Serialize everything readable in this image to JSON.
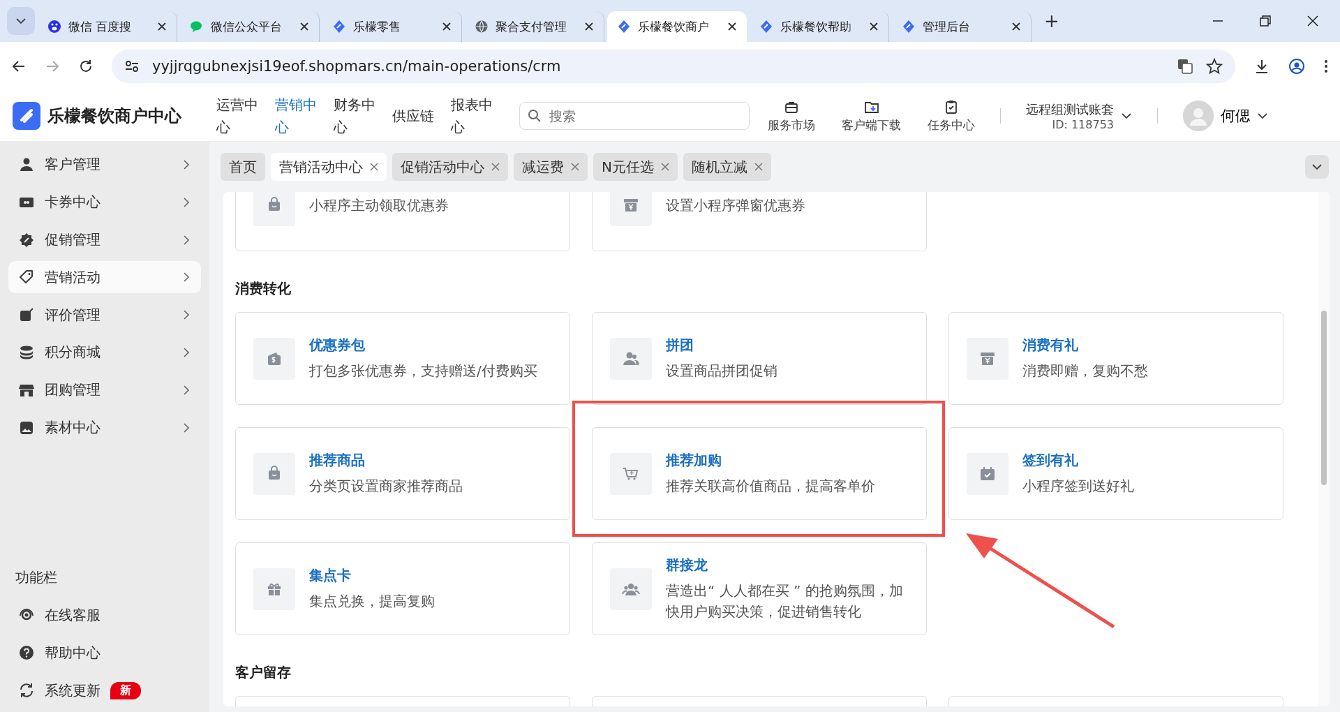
{
  "browser": {
    "tabs": [
      {
        "title": "微信 百度搜",
        "kind": "paw",
        "selected": false
      },
      {
        "title": "微信公众平台",
        "kind": "chat",
        "selected": false
      },
      {
        "title": "乐檬零售",
        "kind": "logo",
        "selected": false
      },
      {
        "title": "聚合支付管理",
        "kind": "globe",
        "selected": false
      },
      {
        "title": "乐檬餐饮商户",
        "kind": "logo",
        "selected": true
      },
      {
        "title": "乐檬餐饮帮助",
        "kind": "logo",
        "selected": false
      },
      {
        "title": "管理后台",
        "kind": "logo",
        "selected": false
      }
    ],
    "new_tab": "+",
    "url": "yyjjrqgubnexjsi19eof.shopmars.cn/main-operations/crm"
  },
  "header": {
    "brand": "乐檬餐饮商户中心",
    "nav": [
      {
        "label": "运营中心",
        "selected": false
      },
      {
        "label": "营销中心",
        "selected": true
      },
      {
        "label": "财务中心",
        "selected": false
      },
      {
        "label": "供应链",
        "selected": false
      },
      {
        "label": "报表中心",
        "selected": false
      }
    ],
    "search": {
      "placeholder": "搜索"
    },
    "tools": [
      {
        "label": "服务市场",
        "kind": "bag"
      },
      {
        "label": "客户端下载",
        "kind": "folder"
      },
      {
        "label": "任务中心",
        "kind": "clipboard"
      }
    ],
    "account": {
      "name": "远程组测试账套",
      "id": "ID: 118753"
    },
    "user": "何偲"
  },
  "page_tabs": [
    {
      "label": "首页",
      "selected": false,
      "closable": false
    },
    {
      "label": "营销活动中心",
      "selected": true,
      "closable": true
    },
    {
      "label": "促销活动中心",
      "selected": false,
      "closable": true
    },
    {
      "label": "减运费",
      "selected": false,
      "closable": true
    },
    {
      "label": "N元任选",
      "selected": false,
      "closable": true
    },
    {
      "label": "随机立减",
      "selected": false,
      "closable": true
    }
  ],
  "sidebar": {
    "items": [
      {
        "label": "客户管理",
        "kind": "person",
        "selected": false
      },
      {
        "label": "卡券中心",
        "kind": "ticket",
        "selected": false
      },
      {
        "label": "促销管理",
        "kind": "discount",
        "selected": false
      },
      {
        "label": "营销活动",
        "kind": "tag",
        "selected": true
      },
      {
        "label": "评价管理",
        "kind": "edit",
        "selected": false
      },
      {
        "label": "积分商城",
        "kind": "coins",
        "selected": false
      },
      {
        "label": "团购管理",
        "kind": "store",
        "selected": false
      },
      {
        "label": "素材中心",
        "kind": "image",
        "selected": false
      }
    ],
    "section_title": "功能栏",
    "tools": [
      {
        "label": "在线客服",
        "kind": "headset"
      },
      {
        "label": "帮助中心",
        "kind": "help"
      },
      {
        "label": "系统更新",
        "kind": "refresh",
        "badge": "新"
      }
    ]
  },
  "content": {
    "top_cards": [
      {
        "desc": "小程序主动领取优惠券",
        "kind": "bag"
      },
      {
        "desc": "设置小程序弹窗优惠券",
        "kind": "yen-box"
      }
    ],
    "sections": [
      {
        "title": "消费转化",
        "cards": [
          {
            "title": "优惠券包",
            "desc": "打包多张优惠券，支持赠送/付费购买",
            "kind": "wallet"
          },
          {
            "title": "拼团",
            "desc": "设置商品拼团促销",
            "kind": "people"
          },
          {
            "title": "消费有礼",
            "desc": "消费即赠，复购不愁",
            "kind": "yen-box"
          },
          {
            "title": "推荐商品",
            "desc": "分类页设置商家推荐商品",
            "kind": "bag"
          },
          {
            "title": "推荐加购",
            "desc": "推荐关联高价值商品，提高客单价",
            "kind": "cart"
          },
          {
            "title": "签到有礼",
            "desc": "小程序签到送好礼",
            "kind": "calendar"
          },
          {
            "title": "集点卡",
            "desc": "集点兑换，提高复购",
            "kind": "gift"
          },
          {
            "title": "群接龙",
            "desc": "营造出“ 人人都在买 ” 的抢购氛围，加快用户购买决策，促进销售转化",
            "kind": "group"
          }
        ]
      },
      {
        "title": "客户留存"
      }
    ]
  }
}
